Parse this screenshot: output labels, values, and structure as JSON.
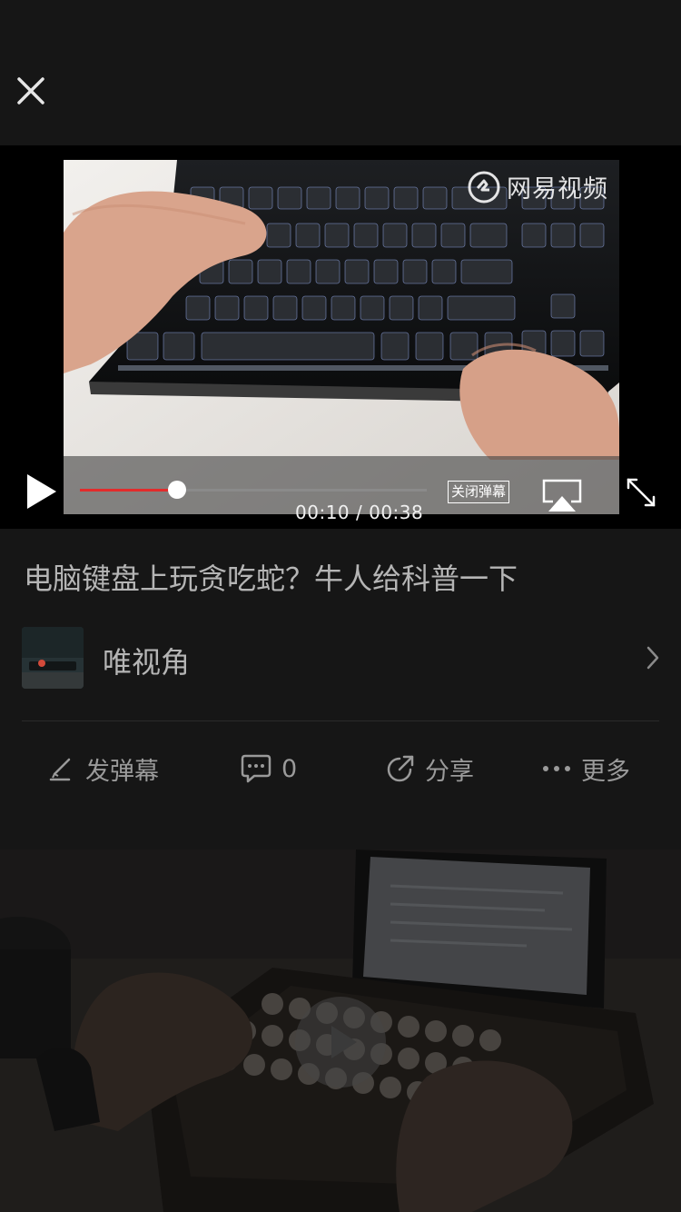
{
  "player": {
    "watermark": "网易视频",
    "danmaku_toggle_label": "关闭弹幕",
    "time_display": "00:10 / 00:38",
    "progress": 0.28
  },
  "video": {
    "title": "电脑键盘上玩贪吃蛇？牛人给科普一下"
  },
  "channel": {
    "name": "唯视角"
  },
  "actions": {
    "danmaku_label": "发弹幕",
    "comment_count": "0",
    "share_label": "分享",
    "more_label": "更多"
  },
  "icons": {
    "close": "close-icon",
    "play": "play-icon",
    "airplay": "airplay-icon",
    "fullscreen": "fullscreen-icon",
    "chevron": "chevron-right-icon",
    "pen": "pen-icon",
    "comment": "comment-icon",
    "share": "share-icon",
    "more": "more-icon"
  },
  "colors": {
    "background": "#161616",
    "accent": "#e22b2b",
    "text": "#b5b5b5"
  }
}
